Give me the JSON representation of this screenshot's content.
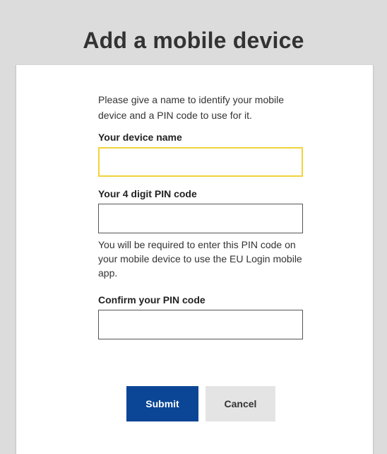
{
  "page": {
    "title": "Add a mobile device"
  },
  "form": {
    "intro_text": "Please give a name to identify your mobile device and a PIN code to use for it.",
    "device_name": {
      "label": "Your device name",
      "value": "",
      "placeholder": ""
    },
    "pin_code": {
      "label": "Your 4 digit PIN code",
      "value": "",
      "placeholder": "",
      "help_text": "You will be required to enter this PIN code on your mobile device to use the EU Login mobile app."
    },
    "confirm_pin": {
      "label": "Confirm your PIN code",
      "value": "",
      "placeholder": ""
    },
    "submit_label": "Submit",
    "cancel_label": "Cancel"
  },
  "colors": {
    "background": "#dcdcdc",
    "card": "#ffffff",
    "focus_border": "#f0d33a",
    "submit_button": "#0b4596",
    "cancel_button": "#e4e4e4"
  }
}
